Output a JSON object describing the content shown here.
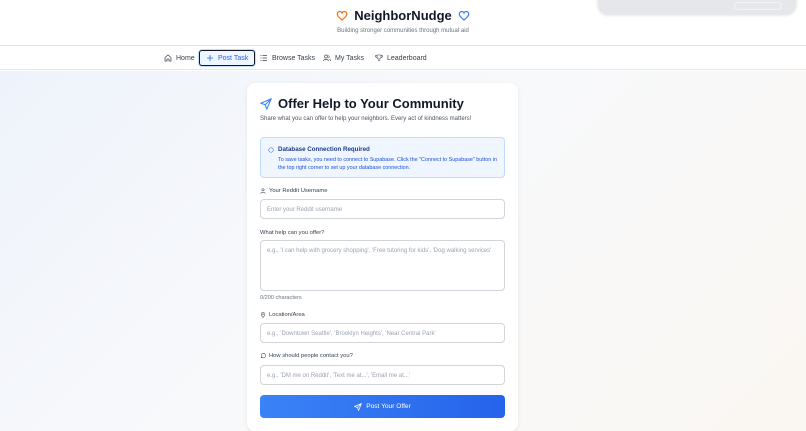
{
  "header": {
    "title": "NeighborNudge",
    "tagline": "Building stronger communities through mutual aid",
    "left_icon": "heart-icon",
    "right_icon": "heart-icon",
    "colors": {
      "left_heart": "#f97316",
      "right_heart": "#3b82f6"
    }
  },
  "nav": {
    "items": [
      {
        "label": "Home",
        "icon": "home-icon"
      },
      {
        "label": "Post Task",
        "icon": "plus-icon",
        "active": true
      },
      {
        "label": "Browse Tasks",
        "icon": "list-icon"
      },
      {
        "label": "My Tasks",
        "icon": "users-icon"
      },
      {
        "label": "Leaderboard",
        "icon": "trophy-icon"
      }
    ]
  },
  "form": {
    "title": "Offer Help to Your Community",
    "subtitle": "Share what you can offer to help your neighbors. Every act of kindness matters!",
    "alert": {
      "title": "Database Connection Required",
      "body": "To save tasks, you need to connect to Supabase. Click the \"Connect to Supabase\" button in the top right corner to set up your database connection."
    },
    "username": {
      "label": "Your Reddit Username",
      "placeholder": "Enter your Reddit username"
    },
    "offer": {
      "label": "What help can you offer?",
      "placeholder": "e.g., 'I can help with grocery shopping', 'Free tutoring for kids', 'Dog walking services'",
      "counter": "0/200 characters"
    },
    "location": {
      "label": "Location/Area",
      "placeholder": "e.g., 'Downtown Seattle', 'Brooklyn Heights', 'Near Central Park'"
    },
    "contact": {
      "label": "How should people contact you?",
      "placeholder": "e.g., 'DM me on Reddit', 'Text me at...', 'Email me at...'"
    },
    "submit_label": "Post Your Offer",
    "accent": "#2563eb"
  }
}
